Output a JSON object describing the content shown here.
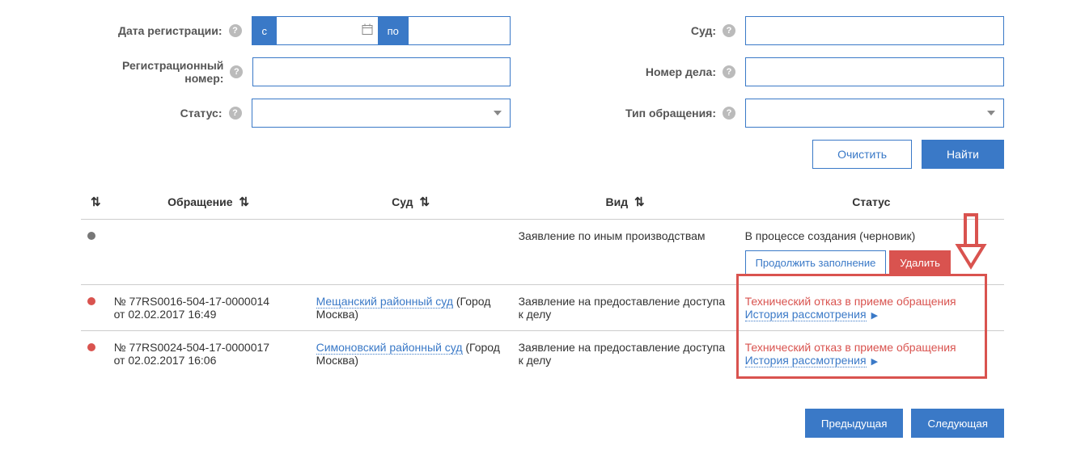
{
  "filters": {
    "reg_date": {
      "label": "Дата регистрации:",
      "from_lbl": "с",
      "to_lbl": "по"
    },
    "court": {
      "label": "Суд:"
    },
    "reg_num": {
      "label": "Регистрационный номер:"
    },
    "case_num": {
      "label": "Номер дела:"
    },
    "status": {
      "label": "Статус:"
    },
    "type": {
      "label": "Тип обращения:"
    }
  },
  "buttons": {
    "clear": "Очистить",
    "find": "Найти",
    "continue": "Продолжить заполнение",
    "delete": "Удалить",
    "prev": "Предыдущая",
    "next": "Следующая"
  },
  "table": {
    "headers": {
      "req": "Обращение",
      "court": "Суд",
      "kind": "Вид",
      "status": "Статус"
    },
    "rows": [
      {
        "dot": "grey",
        "req_line1": "",
        "req_line2": "",
        "court_link": "",
        "court_suffix": "",
        "kind": "Заявление по иным производствам",
        "status": "В процессе создания (черновик)",
        "status_error": "",
        "history": "",
        "show_actions": true
      },
      {
        "dot": "red",
        "req_line1": "№ 77RS0016-504-17-0000014",
        "req_line2": "от 02.02.2017 16:49",
        "court_link": "Мещанский районный суд",
        "court_suffix": " (Город Москва)",
        "kind": "Заявление на предоставление доступа к делу",
        "status": "",
        "status_error": "Технический отказ в приеме обращения",
        "history": "История рассмотрения",
        "show_actions": false
      },
      {
        "dot": "red",
        "req_line1": "№ 77RS0024-504-17-0000017",
        "req_line2": "от 02.02.2017 16:06",
        "court_link": "Симоновский районный суд",
        "court_suffix": " (Город Москва)",
        "kind": "Заявление на предоставление доступа к делу",
        "status": "",
        "status_error": "Технический отказ в приеме обращения",
        "history": "История рассмотрения",
        "show_actions": false
      }
    ]
  }
}
